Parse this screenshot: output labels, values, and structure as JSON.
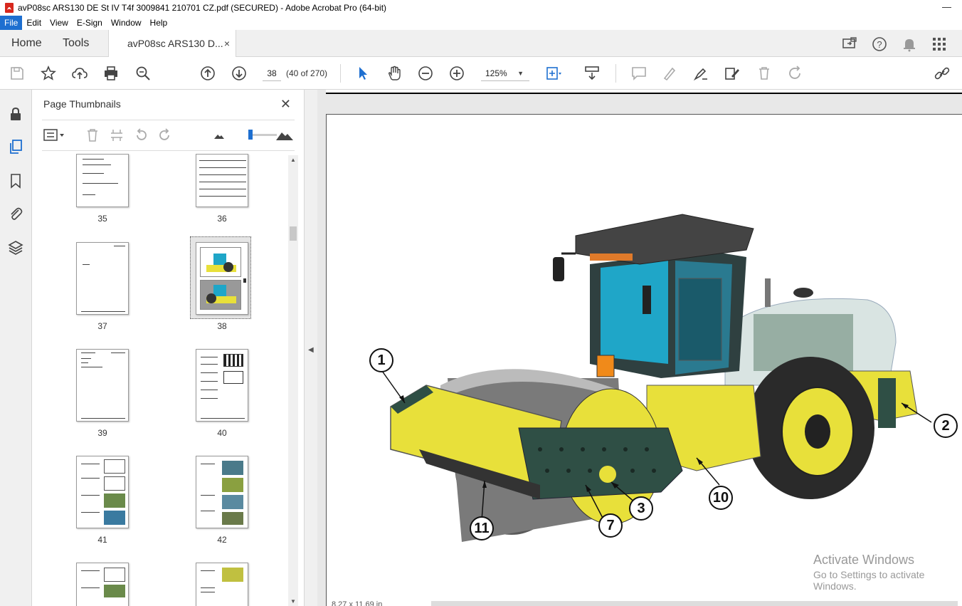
{
  "window": {
    "title": "avP08sc ARS130 DE St IV T4f 3009841 210701 CZ.pdf (SECURED) - Adobe Acrobat Pro (64-bit)",
    "minimize": "—"
  },
  "menu": [
    "File",
    "Edit",
    "View",
    "E-Sign",
    "Window",
    "Help"
  ],
  "tabs": {
    "home": "Home",
    "tools": "Tools",
    "document": "avP08sc ARS130 D...",
    "close": "×"
  },
  "toolbar": {
    "page_current": "38",
    "page_count": "(40 of 270)",
    "zoom": "125%",
    "zoom_arrow": "▼"
  },
  "thumbnails_panel": {
    "title": "Page Thumbnails",
    "close": "✕",
    "pages": [
      {
        "label": "35",
        "type": "form"
      },
      {
        "label": "36",
        "type": "table"
      },
      {
        "label": "37",
        "type": "blank"
      },
      {
        "label": "38",
        "type": "image",
        "selected": true
      },
      {
        "label": "39",
        "type": "text"
      },
      {
        "label": "40",
        "type": "mixed"
      },
      {
        "label": "41",
        "type": "photos"
      },
      {
        "label": "42",
        "type": "photos"
      },
      {
        "label": "",
        "type": "photos"
      },
      {
        "label": "",
        "type": "photos"
      }
    ]
  },
  "document": {
    "callouts": [
      "1",
      "2",
      "3",
      "7",
      "10",
      "11"
    ],
    "page_size": "8,27 x 11,69 in"
  },
  "watermark": {
    "line1": "Activate Windows",
    "line2": "Go to Settings to activate Windows."
  },
  "colors": {
    "accent": "#1e6fd0",
    "machine_yellow": "#e8e03a",
    "cab_blue": "#1fa6c8",
    "frame_green": "#2f4f45"
  }
}
